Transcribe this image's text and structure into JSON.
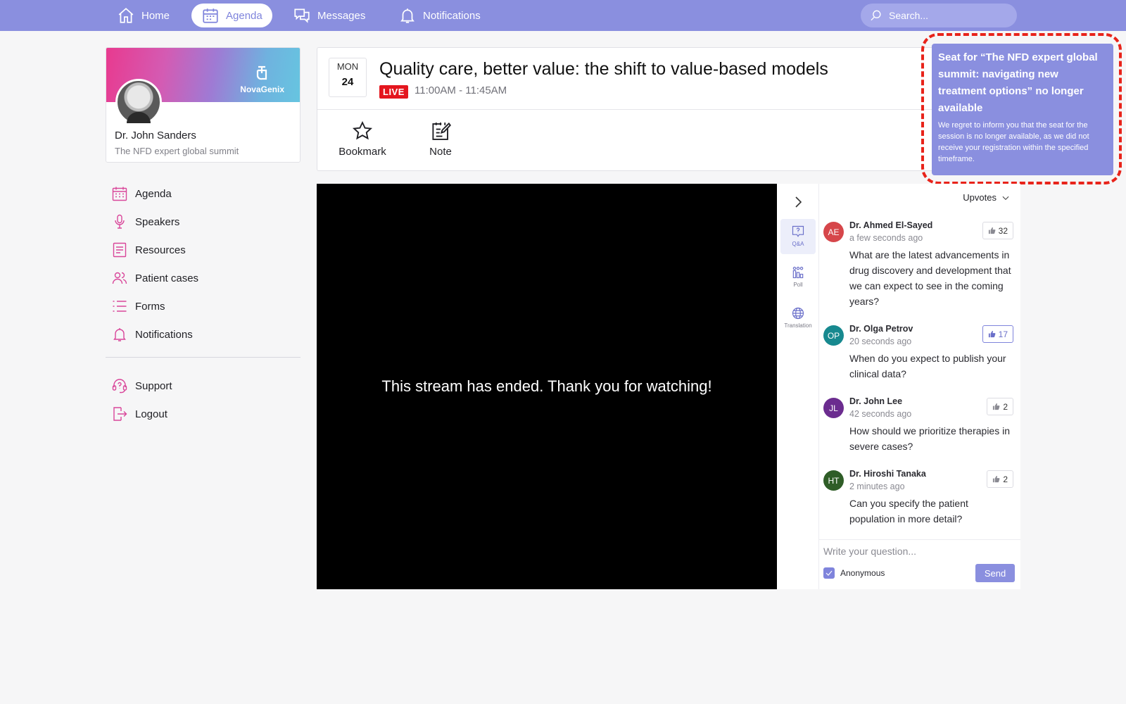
{
  "topnav": {
    "items": [
      {
        "label": "Home",
        "icon": "home-icon"
      },
      {
        "label": "Agenda",
        "icon": "calendar-icon",
        "active": true
      },
      {
        "label": "Messages",
        "icon": "messages-icon"
      },
      {
        "label": "Notifications",
        "icon": "bell-icon"
      }
    ],
    "search_placeholder": "Search..."
  },
  "profile": {
    "name": "Dr. John Sanders",
    "event": "The NFD expert global summit",
    "brand": "NovaGenix"
  },
  "sidebar": {
    "items": [
      {
        "label": "Agenda",
        "icon": "calendar-icon"
      },
      {
        "label": "Speakers",
        "icon": "microphone-icon"
      },
      {
        "label": "Resources",
        "icon": "document-icon"
      },
      {
        "label": "Patient cases",
        "icon": "users-icon"
      },
      {
        "label": "Forms",
        "icon": "list-icon"
      },
      {
        "label": "Notifications",
        "icon": "bell-icon"
      }
    ],
    "secondary": [
      {
        "label": "Support",
        "icon": "support-icon"
      },
      {
        "label": "Logout",
        "icon": "logout-icon"
      }
    ]
  },
  "session": {
    "day_of_week": "MON",
    "day": "24",
    "title": "Quality care, better value: the shift to value-based models",
    "live_label": "LIVE",
    "time": "11:00AM - 11:45AM",
    "actions": {
      "bookmark": "Bookmark",
      "note": "Note"
    }
  },
  "notice": {
    "title": "Seat for “The NFD expert global summit: navigating new treatment options” no longer available",
    "body": "We regret to inform you that the seat for the session is no longer available, as we did not receive your registration within the specified timeframe."
  },
  "video": {
    "message": "This stream has ended. Thank you for watching!"
  },
  "rail": {
    "qa": "Q&A",
    "poll": "Poll",
    "translation": "Translation"
  },
  "qa": {
    "sort_label": "Upvotes",
    "questions": [
      {
        "initials": "AE",
        "color": "#d6464a",
        "name": "Dr. Ahmed El-Sayed",
        "time": "a few seconds ago",
        "text": "What are the latest advancements in drug discovery and development that we can expect to see in the coming years?",
        "upvotes": "32",
        "voted": false
      },
      {
        "initials": "OP",
        "color": "#17898f",
        "name": "Dr. Olga Petrov",
        "time": "20 seconds ago",
        "text": "When do you expect to publish your clinical data?",
        "upvotes": "17",
        "voted": true
      },
      {
        "initials": "JL",
        "color": "#6b2c8f",
        "name": "Dr. John Lee",
        "time": "42 seconds ago",
        "text": "How should we prioritize therapies in severe cases?",
        "upvotes": "2",
        "voted": false
      },
      {
        "initials": "HT",
        "color": "#2f5d27",
        "name": "Dr. Hiroshi Tanaka",
        "time": "2 minutes ago",
        "text": "Can you specify the patient population in more detail?",
        "upvotes": "2",
        "voted": false
      }
    ],
    "input_placeholder": "Write your question...",
    "anonymous_label": "Anonymous",
    "anonymous_checked": true,
    "send_label": "Send"
  },
  "colors": {
    "accent": "#8a8fdf",
    "live": "#e4161e",
    "sidebar_icon": "#d9469a",
    "highlight_outline": "#e8231a"
  }
}
